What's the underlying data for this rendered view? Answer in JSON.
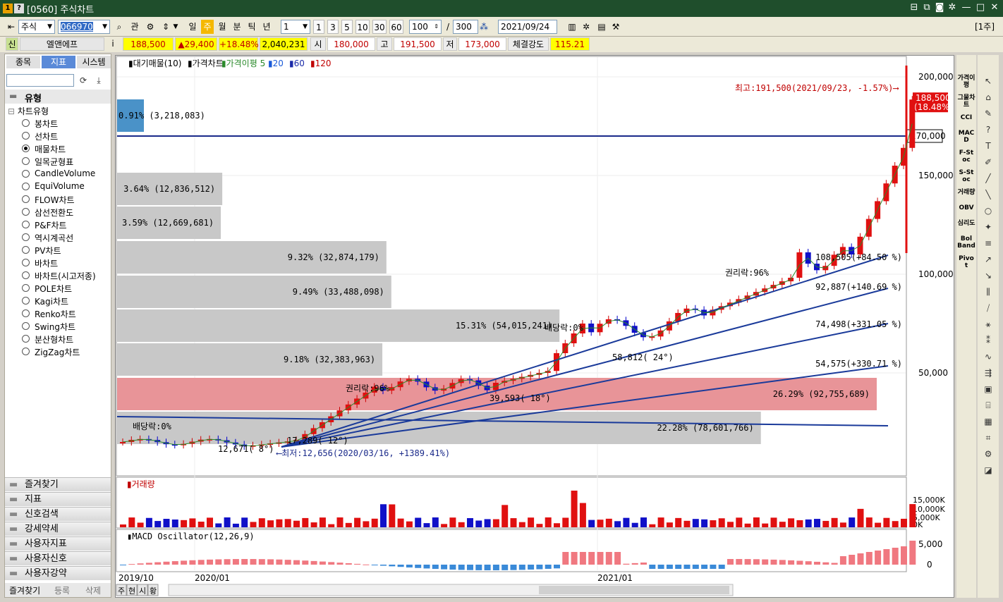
{
  "window": {
    "title": "[0560] 주식차트",
    "close_glyph": "✕",
    "max_glyph": "□",
    "min_glyph": "—"
  },
  "toolbar": {
    "market": "주식",
    "code": "066970",
    "search_btn": "⌕",
    "gwan": "관",
    "periods": [
      "일",
      "주",
      "월",
      "분",
      "틱",
      "년"
    ],
    "period_active": "주",
    "interval": "1",
    "intervals": [
      "1",
      "3",
      "5",
      "10",
      "30",
      "60"
    ],
    "count": "100",
    "slash": "/",
    "total": "300",
    "date": "2021/09/24",
    "unit_label": "[1주]"
  },
  "infobar": {
    "sin": "신",
    "name": "엘앤에프",
    "i": "i",
    "price": "188,500",
    "change": "▲29,400",
    "change_pct": "+18.48%",
    "volume": "2,040,231",
    "open_label": "시",
    "open": "180,000",
    "high_label": "고",
    "high": "191,500",
    "low_label": "저",
    "low": "173,000",
    "strength_label": "체결강도",
    "strength": "115.21"
  },
  "left": {
    "tabs": [
      "종목",
      "지표",
      "시스템"
    ],
    "active_tab": "지표",
    "section": "유형",
    "tree_root": "차트유형",
    "items": [
      "봉차트",
      "선차트",
      "매물차트",
      "일목균형표",
      "CandleVolume",
      "EquiVolume",
      "FLOW차트",
      "삼선전환도",
      "P&F차트",
      "역시계곡선",
      "PV차트",
      "바차트",
      "바차트(시고저종)",
      "POLE차트",
      "Kagi차트",
      "Renko차트",
      "Swing차트",
      "분산형차트",
      "ZigZag차트"
    ],
    "selected": "매물차트",
    "groups": [
      "즐겨찾기",
      "지표",
      "신호검색",
      "강세약세",
      "사용자지표",
      "사용자신호",
      "사용자강약"
    ],
    "bottom_tabs": [
      "즐겨찾기",
      "등록",
      "삭제"
    ]
  },
  "legend": {
    "items": [
      "대기매물(10)",
      "가격차트",
      "가격이평 5",
      "20",
      "60",
      "120"
    ]
  },
  "price_axis": [
    "200,000",
    "150,000",
    "100,000",
    "50,000"
  ],
  "price_marker": {
    "current": "188,500",
    "current_pct": "(18.48%)",
    "line": "170,000"
  },
  "volume_panel": {
    "title": "거래량",
    "ticks": [
      "15,000K",
      "10,000K",
      "5,000K",
      "0K"
    ]
  },
  "macd_panel": {
    "title": "MACD Oscillator(12,26,9)",
    "ticks": [
      "5,000",
      "0"
    ]
  },
  "x_axis": [
    "2019/10",
    "2020/01",
    "2021/01"
  ],
  "bottom_tabs": [
    "주",
    "현",
    "시",
    "황"
  ],
  "annotations": {
    "high": "최고:191,500(2021/09/23, -1.57%)⟶",
    "low": "⟵최저:12,656(2020/03/16, +1389.41%)",
    "rights1": "권리락:96%",
    "rights2": "권리락:96%",
    "div1": "배당락:0%",
    "div2": "배당락:0%",
    "t1": "108,505(+84.50 %)",
    "t2": "92,887(+140.69 %)",
    "t3": "74,498(+331.05 %)",
    "t4": "54,575(+330.71 %)",
    "t5": "58,812( 24°)",
    "t6": "39,593( 18°)",
    "t7": "17,289( 12°)",
    "t8": "12,671( 8°)"
  },
  "supply_bars": [
    {
      "label": "0.91% (3,218,083)",
      "pct": 0.91
    },
    {
      "label": "3.64% (12,836,512)",
      "pct": 3.64
    },
    {
      "label": "3.59% (12,669,681)",
      "pct": 3.59
    },
    {
      "label": "9.32% (32,874,179)",
      "pct": 9.32
    },
    {
      "label": "9.49% (33,488,098)",
      "pct": 9.49
    },
    {
      "label": "15.31% (54,015,241)",
      "pct": 15.31
    },
    {
      "label": "9.18% (32,383,963)",
      "pct": 9.18
    },
    {
      "label": "26.29% (92,755,689)",
      "pct": 26.29
    },
    {
      "label": "22.28% (78,601,766)",
      "pct": 22.28
    }
  ],
  "right_tools": [
    "가격이평",
    "그물차트",
    "CCI",
    "MACD",
    "F-Stoc",
    "S-Stoc",
    "거래량",
    "OBV",
    "심리도",
    "Bol Band",
    "Pivot"
  ],
  "colors": {
    "up": "#e01010",
    "down": "#1010c8",
    "title_bg": "#1f4e2c",
    "highlight": "#ffff00"
  }
}
